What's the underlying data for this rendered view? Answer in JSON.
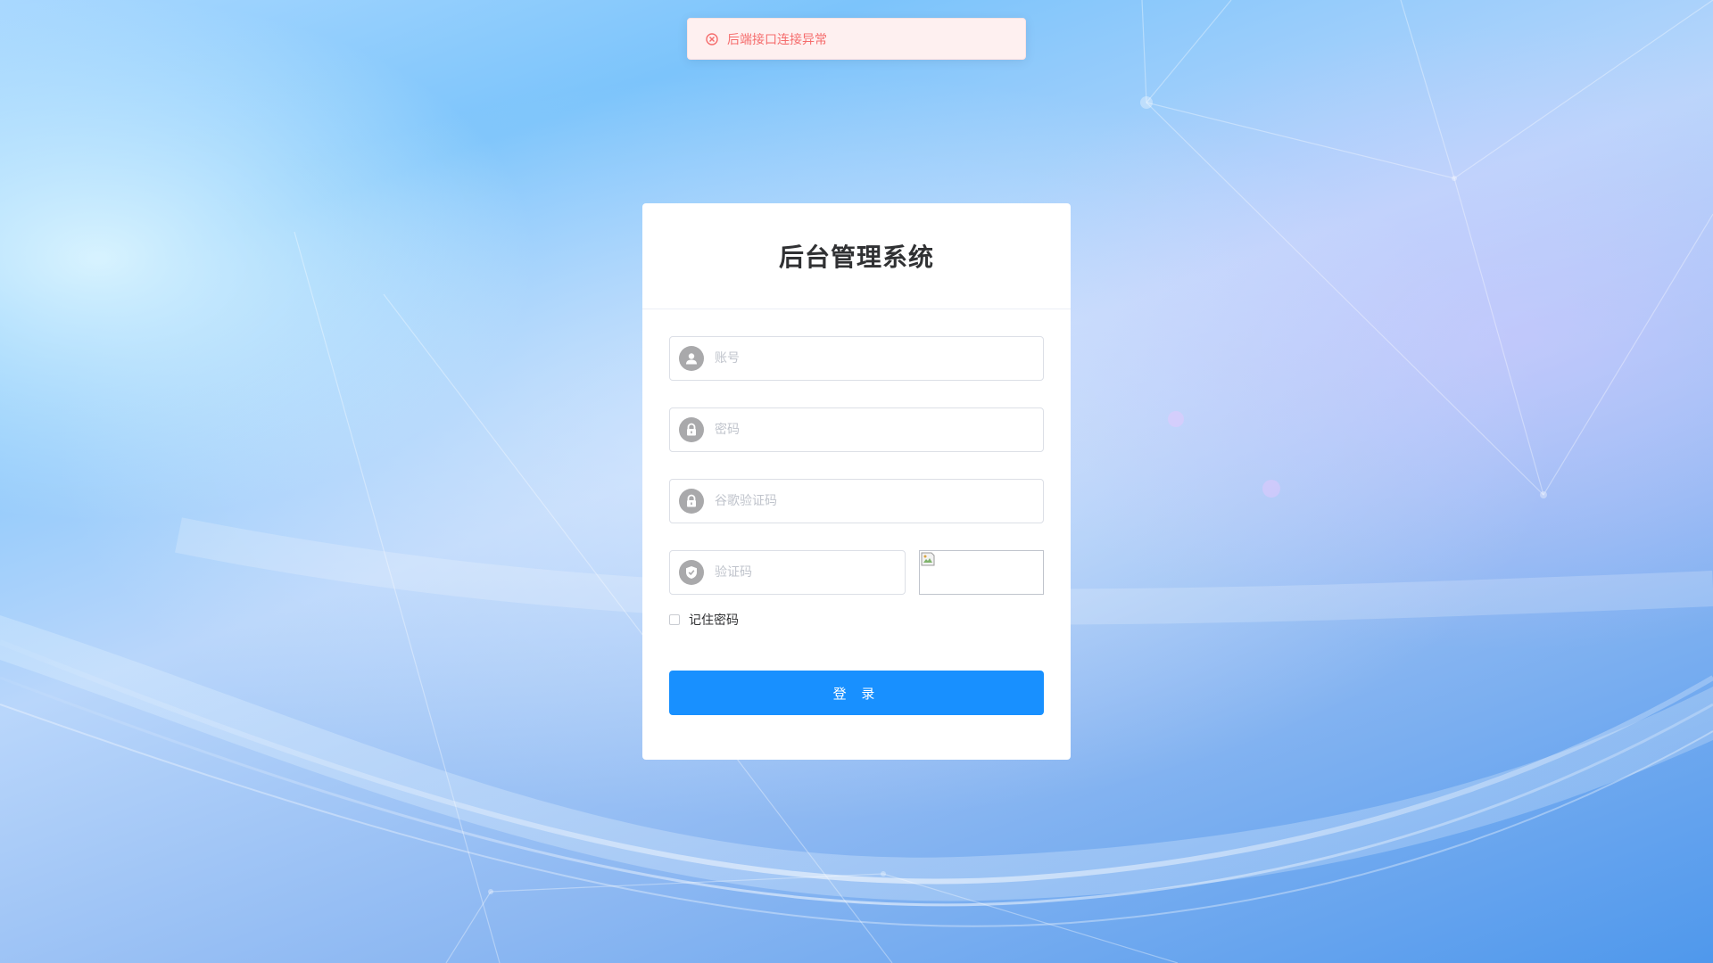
{
  "alert": {
    "type": "error",
    "icon": "error-circle-icon",
    "message": "后端接口连接异常"
  },
  "login": {
    "title": "后台管理系统",
    "username": {
      "icon": "user-icon",
      "placeholder": "账号",
      "value": ""
    },
    "password": {
      "icon": "lock-icon",
      "placeholder": "密码",
      "value": ""
    },
    "google_code": {
      "icon": "lock-icon",
      "placeholder": "谷歌验证码",
      "value": ""
    },
    "captcha": {
      "icon": "shield-check-icon",
      "placeholder": "验证码",
      "value": ""
    },
    "remember_label": "记住密码",
    "remember_checked": false,
    "submit_label": "登 录"
  },
  "colors": {
    "primary": "#1890ff",
    "error_text": "#f56c6c",
    "error_bg": "#fef0f0",
    "icon_bg": "#a9a9ab"
  }
}
